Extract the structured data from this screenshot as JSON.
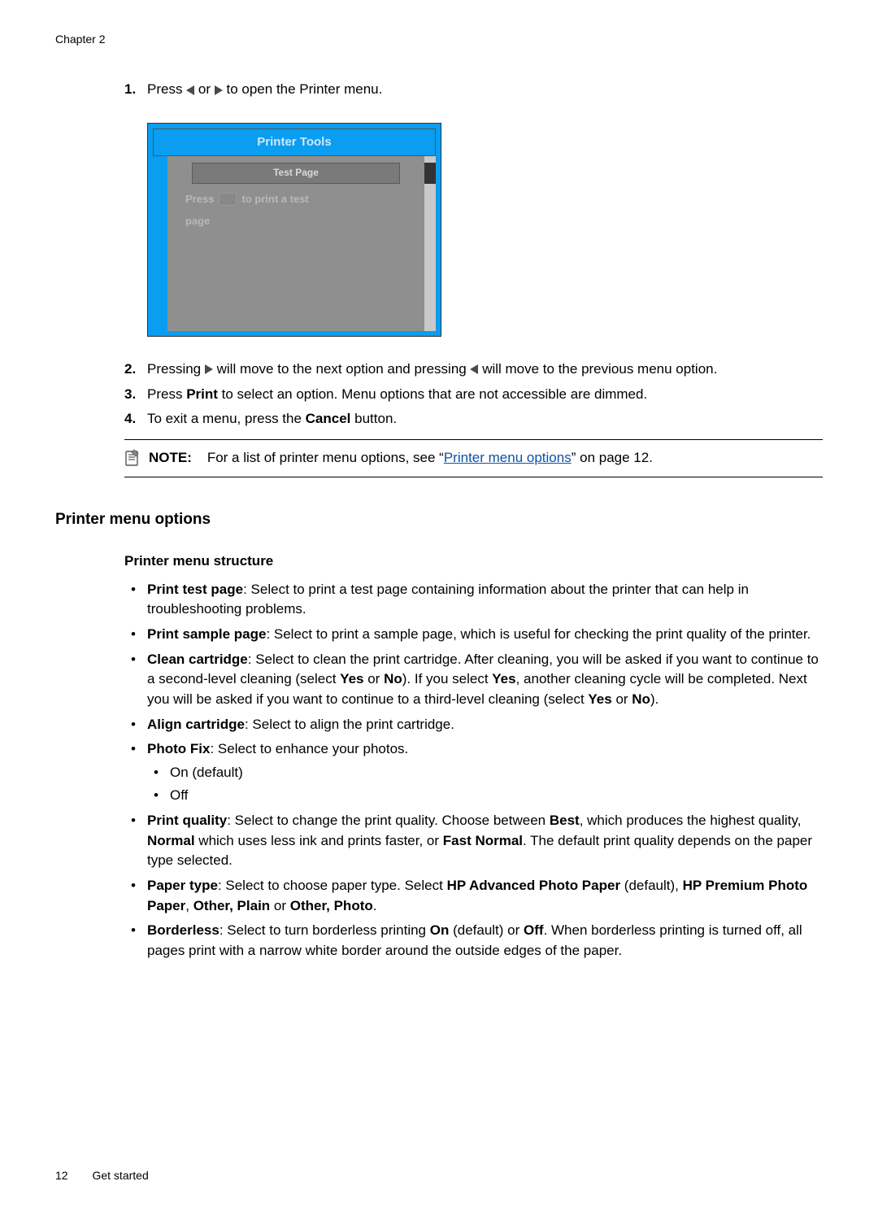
{
  "chapter_label": "Chapter 2",
  "steps": {
    "s1": {
      "prefix": "Press ",
      "mid": " or ",
      "suffix": " to open the Printer menu."
    },
    "s2": {
      "prefix": "Pressing ",
      "mid1": " will move to the next option and pressing ",
      "mid2": " will move to the previous menu option."
    },
    "s3": {
      "prefix": "Press ",
      "bold1": "Print",
      "suffix": " to select an option. Menu options that are not accessible are dimmed."
    },
    "s4": {
      "prefix": "To exit a menu, press the ",
      "bold1": "Cancel",
      "suffix": " button."
    }
  },
  "printer_screen": {
    "title": "Printer Tools",
    "tab": "Test Page",
    "line1a": "Press",
    "line1b": "to print a test",
    "line2": "page"
  },
  "note": {
    "label": "NOTE:",
    "text_before": "For a list of printer menu options, see ",
    "link_open": "“",
    "link_text": "Printer menu options",
    "link_close": "”",
    "text_after": " on page 12."
  },
  "section_heading": "Printer menu options",
  "sub_heading": "Printer menu structure",
  "options": {
    "print_test": {
      "name": "Print test page",
      "desc": ": Select to print a test page containing information about the printer that can help in troubleshooting problems."
    },
    "print_sample": {
      "name": "Print sample page",
      "desc": ": Select to print a sample page, which is useful for checking the print quality of the printer."
    },
    "clean": {
      "name": "Clean cartridge",
      "p1": ": Select to clean the print cartridge. After cleaning, you will be asked if you want to continue to a second-level cleaning (select ",
      "yes1": "Yes",
      "or1": " or ",
      "no1": "No",
      "p2": "). If you select ",
      "yes2": "Yes",
      "p3": ", another cleaning cycle will be completed. Next you will be asked if you want to continue to a third-level cleaning (select ",
      "yes3": "Yes",
      "or2": " or ",
      "no2": "No",
      "p4": ")."
    },
    "align": {
      "name": "Align cartridge",
      "desc": ": Select to align the print cartridge."
    },
    "photo_fix": {
      "name": "Photo Fix",
      "desc": ": Select to enhance your photos.",
      "sub1": "On (default)",
      "sub2": "Off"
    },
    "print_quality": {
      "name": "Print quality",
      "p1": ": Select to change the print quality. Choose between ",
      "b1": "Best",
      "p2": ", which produces the highest quality, ",
      "b2": "Normal",
      "p3": " which uses less ink and prints faster, or ",
      "b3": "Fast Normal",
      "p4": ". The default print quality depends on the paper type selected."
    },
    "paper_type": {
      "name": "Paper type",
      "p1": ": Select to choose paper type. Select ",
      "b1": "HP Advanced Photo Paper",
      "p2": " (default), ",
      "b2": "HP Premium Photo Paper",
      "p3": ", ",
      "b3": "Other, Plain",
      "p4": " or ",
      "b4": "Other, Photo",
      "p5": "."
    },
    "borderless": {
      "name": "Borderless",
      "p1": ": Select to turn borderless printing ",
      "b1": "On",
      "p2": " (default) or ",
      "b2": "Off",
      "p3": ". When borderless printing is turned off, all pages print with a narrow white border around the outside edges of the paper."
    }
  },
  "footer": {
    "page_number": "12",
    "section": "Get started"
  }
}
